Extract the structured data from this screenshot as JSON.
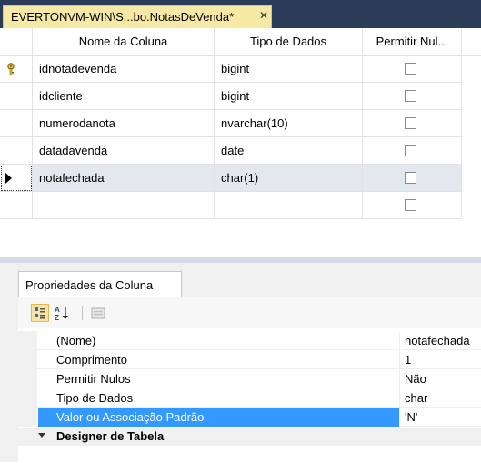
{
  "tab": {
    "title": "EVERTONVM-WIN\\S...bo.NotasDeVenda*",
    "close": "✕"
  },
  "grid": {
    "headers": [
      "Nome da Coluna",
      "Tipo de Dados",
      "Permitir Nul..."
    ],
    "rows": [
      {
        "name": "idnotadevenda",
        "type": "bigint",
        "allow_nulls": false,
        "primary_key": true
      },
      {
        "name": "idcliente",
        "type": "bigint",
        "allow_nulls": false
      },
      {
        "name": "numerodanota",
        "type": "nvarchar(10)",
        "allow_nulls": false
      },
      {
        "name": "datadavenda",
        "type": "date",
        "allow_nulls": false
      },
      {
        "name": "notafechada",
        "type": "char(1)",
        "allow_nulls": false,
        "selected": true
      },
      {
        "name": "",
        "type": "",
        "allow_nulls": false
      }
    ]
  },
  "properties": {
    "tab_label": "Propriedades da Coluna",
    "rows": [
      {
        "name": "(Nome)",
        "value": "notafechada"
      },
      {
        "name": "Comprimento",
        "value": "1"
      },
      {
        "name": "Permitir Nulos",
        "value": "Não"
      },
      {
        "name": "Tipo de Dados",
        "value": "char"
      },
      {
        "name": "Valor ou Associação Padrão",
        "value": "'N'",
        "highlighted": true
      }
    ],
    "category": "Designer de Tabela"
  }
}
